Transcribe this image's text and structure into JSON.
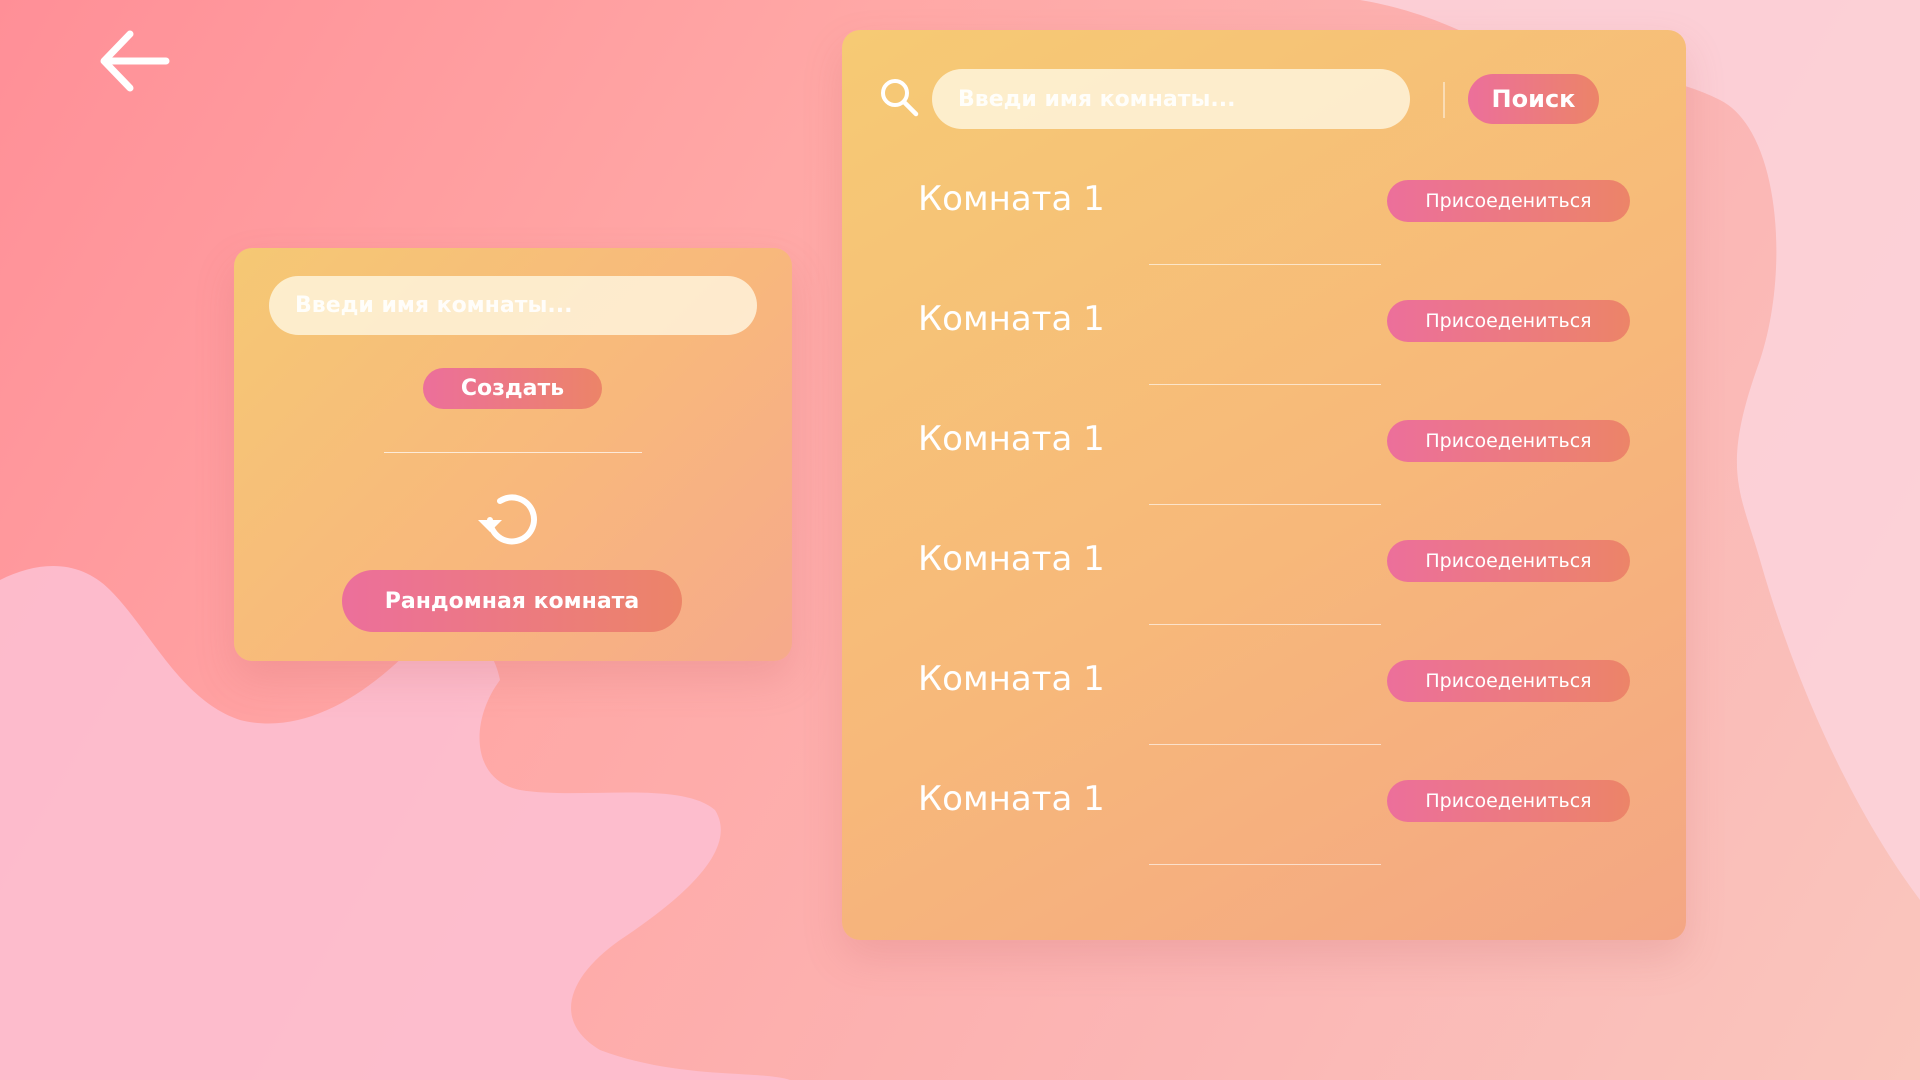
{
  "colors": {
    "accent_gradient_start": "#ec6f9b",
    "accent_gradient_end": "#ec8468",
    "panel_gradient_start": "#f6ca74",
    "panel_gradient_end": "#f4a684",
    "background": "#ff9aa0",
    "text": "#ffffff"
  },
  "header": {
    "back_icon": "arrow-left-icon"
  },
  "create_panel": {
    "room_name_placeholder": "Введи имя комнаты...",
    "create_label": "Создать",
    "refresh_icon": "refresh-icon",
    "random_room_label": "Рандомная комната"
  },
  "rooms_panel": {
    "search_icon": "search-icon",
    "search_placeholder": "Введи имя комнаты...",
    "search_label": "Поиск",
    "rooms": [
      {
        "name": "Комната 1",
        "join_label": "Присоедениться"
      },
      {
        "name": "Комната 1",
        "join_label": "Присоедениться"
      },
      {
        "name": "Комната 1",
        "join_label": "Присоедениться"
      },
      {
        "name": "Комната 1",
        "join_label": "Присоедениться"
      },
      {
        "name": "Комната 1",
        "join_label": "Присоедениться"
      },
      {
        "name": "Комната 1",
        "join_label": "Присоедениться"
      }
    ]
  }
}
